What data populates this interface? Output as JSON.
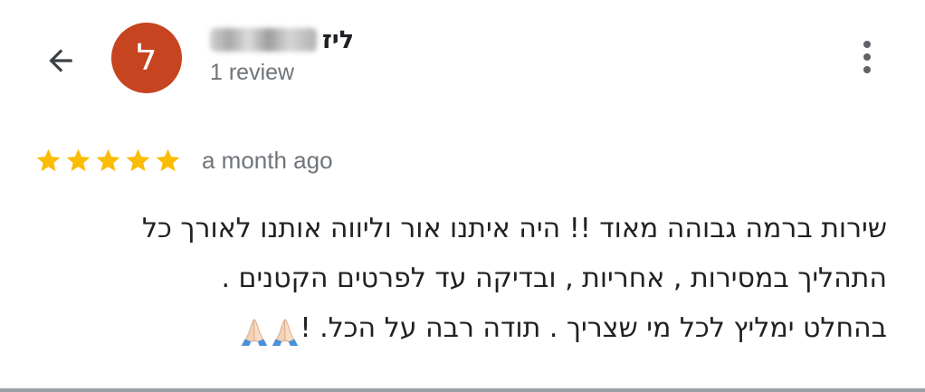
{
  "header": {
    "back_icon": "arrow-back-icon",
    "avatar_letter": "ל",
    "avatar_color": "#c6441f",
    "author_name": "ליז",
    "review_count": "1 review",
    "more_icon": "more-vert-icon"
  },
  "review": {
    "rating": 5,
    "max_rating": 5,
    "star_color": "#fbbc04",
    "time": "a month ago",
    "lines": [
      "שירות ברמה גבוהה מאוד !! היה איתנו אור וליווה אותנו לאורך כל",
      "התהליך במסירות , אחריות , ובדיקה עד לפרטים הקטנים .",
      "בהחלט ימליץ לכל מי שצריך . תודה רבה על הכל. !"
    ],
    "emoji_icon": "folded-hands-icon"
  }
}
